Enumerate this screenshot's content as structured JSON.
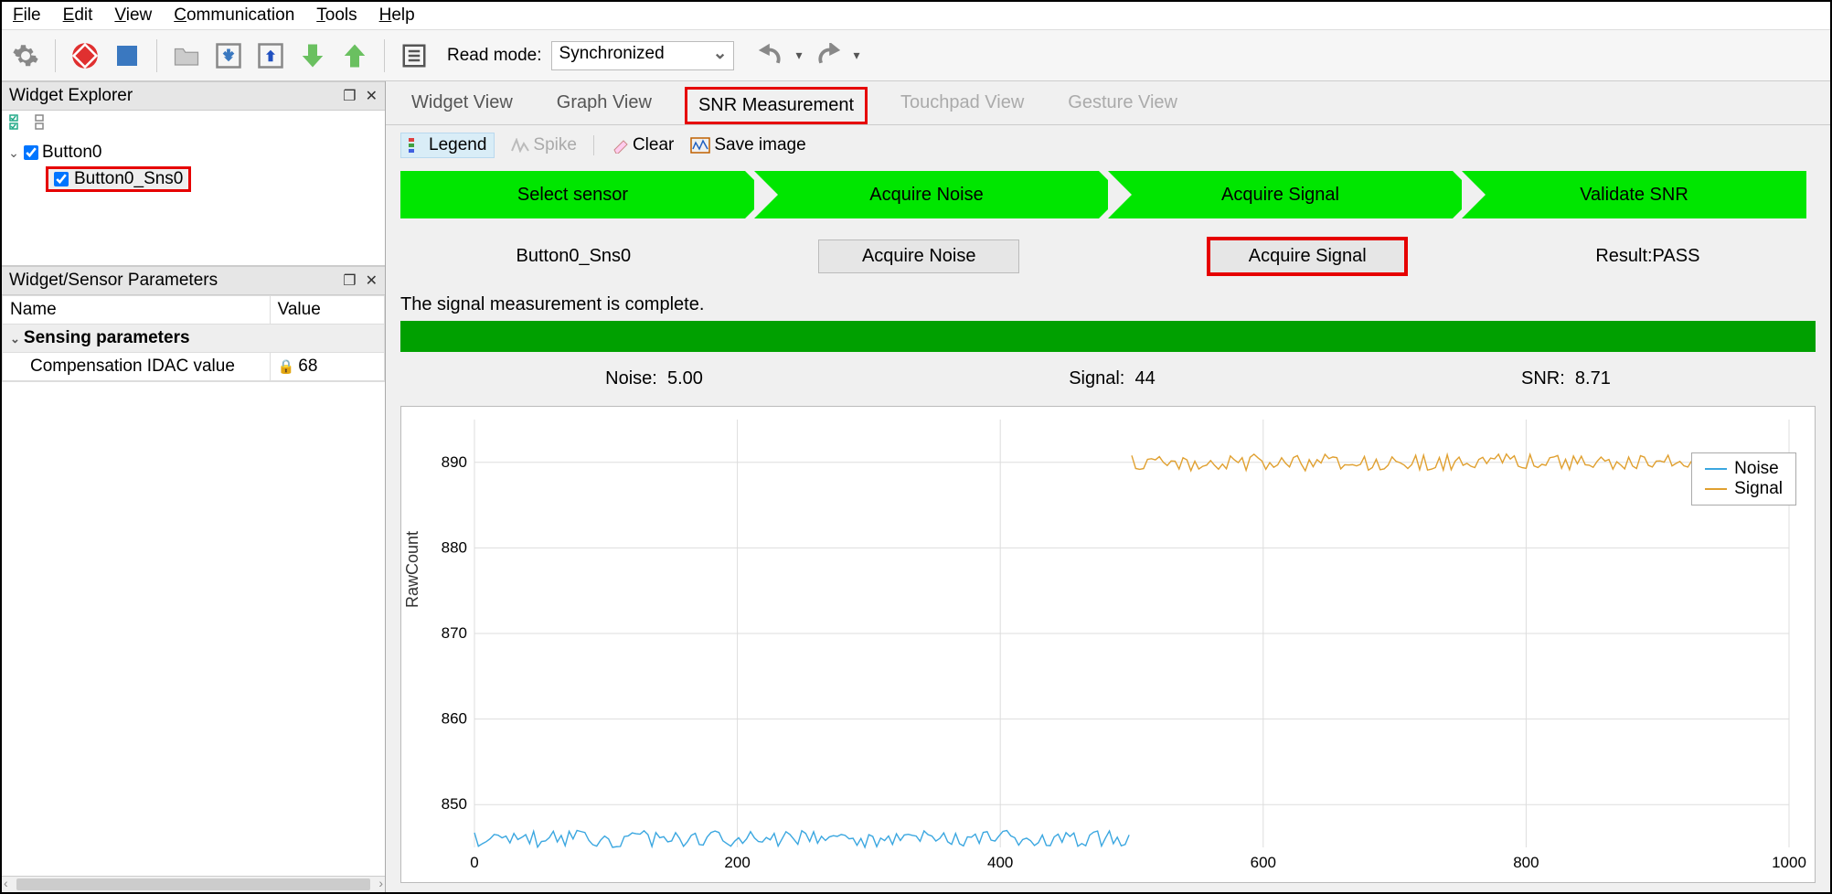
{
  "menu": {
    "items": [
      "File",
      "Edit",
      "View",
      "Communication",
      "Tools",
      "Help"
    ]
  },
  "toolbar": {
    "read_label": "Read mode:",
    "read_value": "Synchronized"
  },
  "panels": {
    "explorer": {
      "title": "Widget Explorer",
      "tree": {
        "root": "Button0",
        "child": "Button0_Sns0"
      }
    },
    "params": {
      "title": "Widget/Sensor Parameters",
      "col_name": "Name",
      "col_value": "Value",
      "group": "Sensing parameters",
      "row_name": "Compensation IDAC value",
      "row_value": "68"
    }
  },
  "tabs": [
    "Widget View",
    "Graph View",
    "SNR Measurement",
    "Touchpad View",
    "Gesture View"
  ],
  "subtoolbar": {
    "legend": "Legend",
    "spike": "Spike",
    "clear": "Clear",
    "save": "Save image"
  },
  "chevrons": [
    "Select sensor",
    "Acquire Noise",
    "Acquire Signal",
    "Validate SNR"
  ],
  "actions": {
    "sensor": "Button0_Sns0",
    "btn_noise": "Acquire Noise",
    "btn_signal": "Acquire Signal",
    "result": "Result:PASS"
  },
  "status": "The signal measurement is complete.",
  "metrics": {
    "noise_label": "Noise:",
    "noise_val": "5.00",
    "signal_label": "Signal:",
    "signal_val": "44",
    "snr_label": "SNR:",
    "snr_val": "8.71"
  },
  "chart_data": {
    "type": "line",
    "ylabel": "RawCount",
    "x_ticks": [
      0,
      200,
      400,
      600,
      800,
      1000
    ],
    "y_ticks": [
      850,
      860,
      870,
      880,
      890
    ],
    "xlim": [
      0,
      1000
    ],
    "ylim": [
      845,
      895
    ],
    "legend": [
      "Noise",
      "Signal"
    ],
    "series": [
      {
        "name": "Noise",
        "color": "#3ba7e0",
        "segments": [
          {
            "x0": 0,
            "x1": 500,
            "y": 846
          }
        ]
      },
      {
        "name": "Signal",
        "color": "#e0a030",
        "segments": [
          {
            "x0": 500,
            "x1": 1000,
            "y": 890
          }
        ]
      }
    ]
  }
}
